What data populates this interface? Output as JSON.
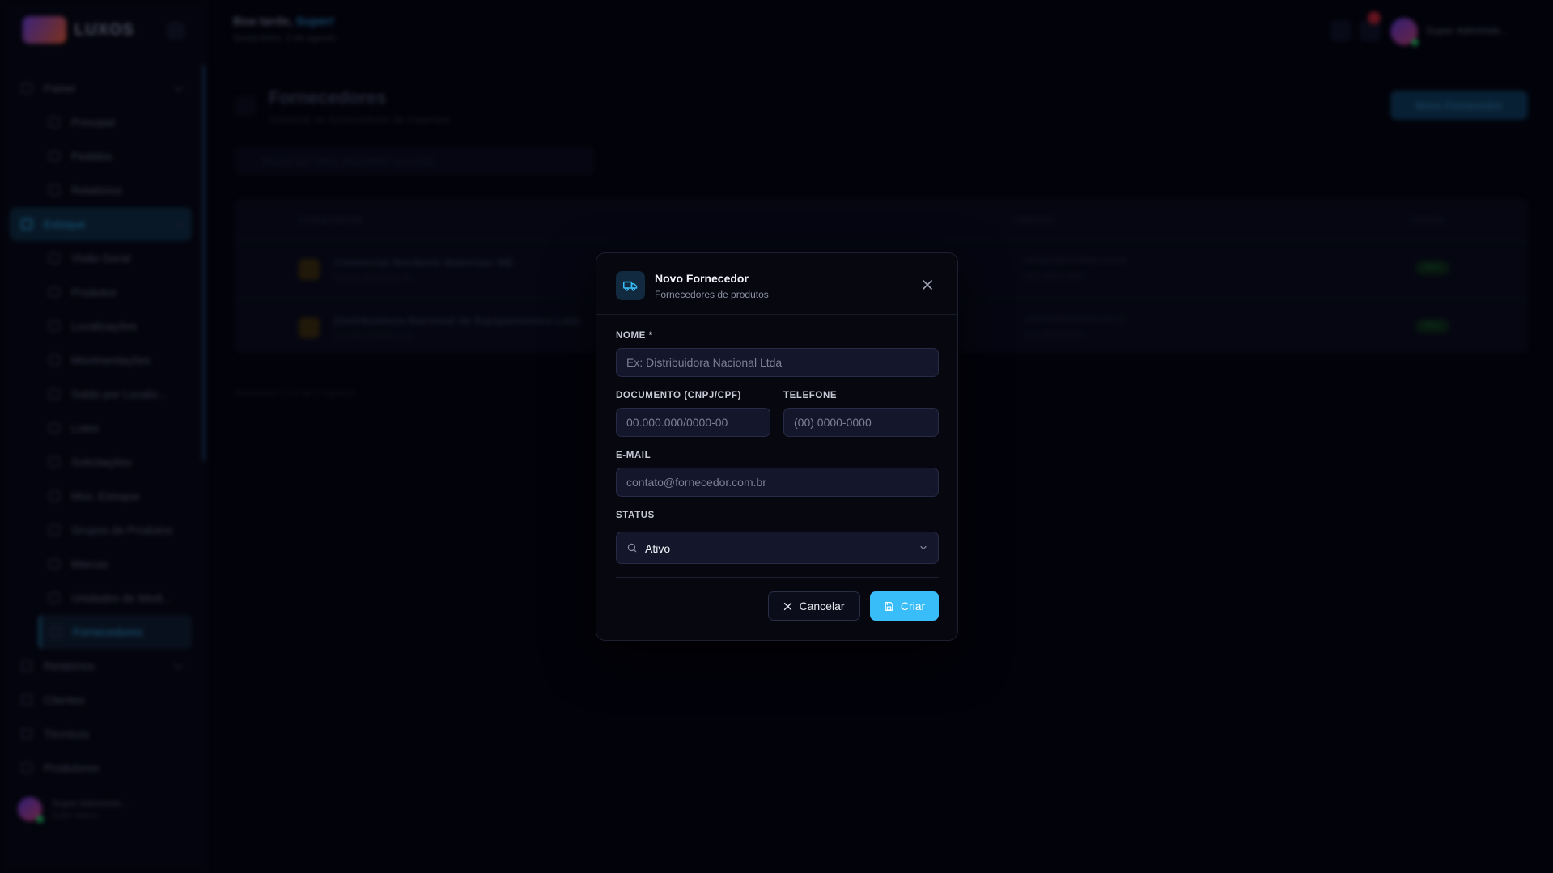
{
  "app": {
    "logo_text": "LUXOS",
    "user_name": "Super Administr...",
    "user_role": "Super Admin"
  },
  "header": {
    "greeting": "Boa tarde,",
    "greeting_name": "Super!",
    "date": "Sexta-feira, 2 de agosto"
  },
  "sidebar": {
    "items": [
      {
        "label": "Painel",
        "icon": "grid-icon",
        "type": "group"
      },
      {
        "label": "Principal",
        "icon": "home-icon",
        "type": "sub"
      },
      {
        "label": "Pedidos",
        "icon": "cart-icon",
        "type": "sub"
      },
      {
        "label": "Relatórios",
        "icon": "chart-icon",
        "type": "sub"
      },
      {
        "label": "Estoque",
        "icon": "box-icon",
        "type": "group-active"
      },
      {
        "label": "Visão Geral",
        "icon": "eye-icon",
        "type": "sub"
      },
      {
        "label": "Produtos",
        "icon": "package-icon",
        "type": "sub"
      },
      {
        "label": "Localizações",
        "icon": "pin-icon",
        "type": "sub"
      },
      {
        "label": "Movimentações",
        "icon": "arrows-icon",
        "type": "sub"
      },
      {
        "label": "Saldo por Localiz...",
        "icon": "layers-icon",
        "type": "sub"
      },
      {
        "label": "Lotes",
        "icon": "tag-icon",
        "type": "sub"
      },
      {
        "label": "Solicitações",
        "icon": "clipboard-icon",
        "type": "sub"
      },
      {
        "label": "Mov. Estoque",
        "icon": "swap-icon",
        "type": "sub"
      },
      {
        "label": "Grupos de Produtos",
        "icon": "folder-icon",
        "type": "sub"
      },
      {
        "label": "Marcas",
        "icon": "bookmark-icon",
        "type": "sub"
      },
      {
        "label": "Unidades de Medi...",
        "icon": "ruler-icon",
        "type": "sub"
      },
      {
        "label": "Fornecedores",
        "icon": "truck-icon",
        "type": "sub-current"
      },
      {
        "label": "Relatórios",
        "icon": "chart-icon",
        "type": "group"
      },
      {
        "label": "Clientes",
        "icon": "users-icon",
        "type": "plain"
      },
      {
        "label": "Técnicos",
        "icon": "wrench-icon",
        "type": "plain"
      },
      {
        "label": "Produtores",
        "icon": "building-icon",
        "type": "plain"
      }
    ]
  },
  "page": {
    "title": "Fornecedores",
    "subtitle": "Gerencie os fornecedores de materiais",
    "new_button": "Novo Fornecedor",
    "search_placeholder": "Buscar por nome, documento ou e-mail...",
    "columns": [
      "FORNECEDOR",
      "CONTATO",
      "STATUS"
    ],
    "rows": [
      {
        "name": "Comercial Nordeste Materiais ME",
        "doc": "00.111.000/0001-00",
        "email": "contato@nordeste.com.br",
        "phone": "(81) 3000-0000",
        "status": "Ativo"
      },
      {
        "name": "Distribuidora Nacional de Equipamentos Ltda",
        "doc": "12.345.678/0001-90",
        "email": "contato@nacional.com.br",
        "phone": "(11) 3000-0000",
        "status": "Ativo"
      }
    ],
    "pagination": "Mostrando 1 a 2 de 2 registros"
  },
  "modal": {
    "title": "Novo Fornecedor",
    "subtitle": "Fornecedores de produtos",
    "icon": "truck-icon",
    "fields": {
      "nome": {
        "label": "NOME *",
        "placeholder": "Ex: Distribuidora Nacional Ltda",
        "value": ""
      },
      "documento": {
        "label": "DOCUMENTO (CNPJ/CPF)",
        "placeholder": "00.000.000/0000-00",
        "value": ""
      },
      "telefone": {
        "label": "TELEFONE",
        "placeholder": "(00) 0000-0000",
        "value": ""
      },
      "email": {
        "label": "E-MAIL",
        "placeholder": "contato@fornecedor.com.br",
        "value": ""
      },
      "status": {
        "label": "STATUS",
        "value": "Ativo"
      }
    },
    "cancel_label": "Cancelar",
    "create_label": "Criar"
  },
  "colors": {
    "accent": "#38bdf8",
    "background": "#02030a",
    "modal_bg": "#06070f",
    "input_bg": "#14172b"
  }
}
